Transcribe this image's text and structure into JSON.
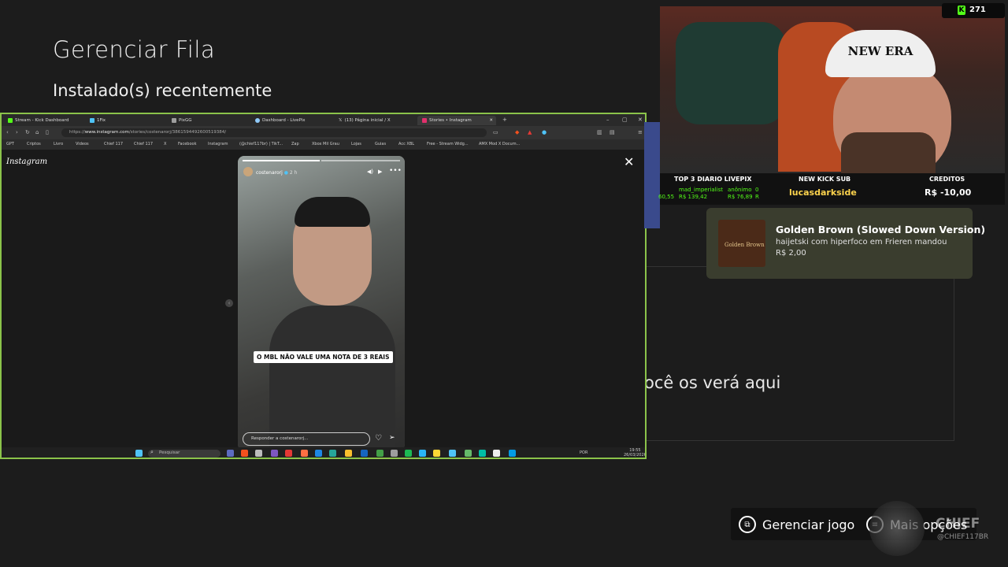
{
  "xbox": {
    "title": "Gerenciar Fila",
    "subtitle": "Instalado(s) recentemente",
    "empty_text": "ocê os verá aqui",
    "bottom_bar": {
      "manage_game": "Gerenciar jogo",
      "more_options": "Mais opções"
    }
  },
  "browser": {
    "tabs": [
      {
        "label": "Stream - Kick Dashboard",
        "color": "#53fc18"
      },
      {
        "label": "1Fix",
        "color": "#4fc3f7"
      },
      {
        "label": "PixGG",
        "color": "#9e9e9e"
      },
      {
        "label": "Dashboard - LivePix",
        "color": "#90caf9"
      },
      {
        "label": "(13) Página inicial / X",
        "color": "#ffffff"
      },
      {
        "label": "Stories • Instagram",
        "color": "#e1306c"
      }
    ],
    "url_prefix": "https://",
    "url_host": "www.instagram.com",
    "url_path": "/stories/costenarorj/3861594492600519384/",
    "bookmarks": [
      "GPT",
      "Criptos",
      "Livro",
      "Videos",
      "Chief 117",
      "Chief 117",
      "X",
      "Facebook",
      "Instagram",
      "(@chief117br) | TikT...",
      "Zap",
      "Xbox Mil Grau",
      "Lojas",
      "Guias",
      "Acc XBL",
      "Free - Stream Widg...",
      "AMX Mod X Docum..."
    ],
    "instagram_logo": "Instagram",
    "close_icon": "✕",
    "story": {
      "username": "costenarorj",
      "time": "2 h",
      "caption": "O MBL NÃO VALE UMA NOTA DE 3 REAIS",
      "reply_placeholder": "Responder a costenarorj..."
    },
    "taskbar": {
      "search": "Pesquisar",
      "lang": "POR",
      "time": "19:55",
      "date": "26/03/2026"
    }
  },
  "stream": {
    "kick_viewers": "271",
    "cap_text": "NEW ERA",
    "info": {
      "top3_header": "TOP 3 DIARIO LIVEPIX",
      "top3_rows": [
        {
          "name": "mad_imperialist",
          "amount": "R$ 139,42"
        },
        {
          "name": "anônimo",
          "amount": "R$ 76,89"
        }
      ],
      "top3_partial": "60,55",
      "top3_col3_1": "0",
      "top3_col3_2": "R",
      "new_sub_header": "NEW KICK SUB",
      "new_sub_name": "lucasdarkside",
      "credits_header": "CREDITOS",
      "credits_value": "R$ -10,00"
    },
    "donation": {
      "song": "Golden Brown (Slowed Down Version)",
      "donor_line": "haijetski com hiperfoco em Frieren mandou",
      "amount": "R$ 2,00",
      "album_text": "Golden Brown"
    },
    "brand": {
      "name": "CHIEF",
      "handle": "@CHIEF117BR"
    }
  }
}
